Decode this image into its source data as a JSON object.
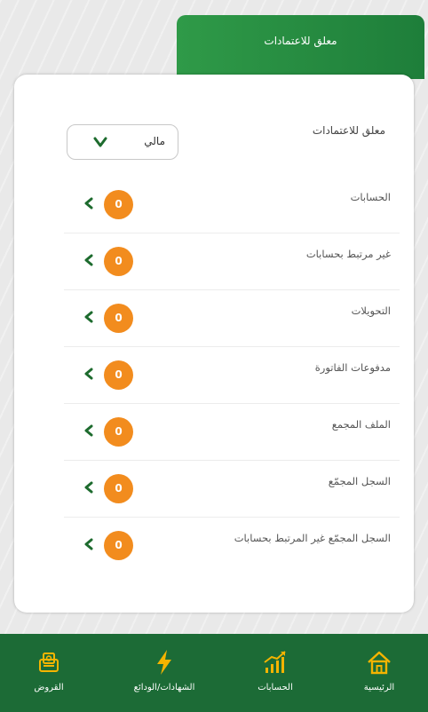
{
  "header": {
    "tab_label": "معلق للاعتمادات"
  },
  "filter": {
    "label": "معلق للاعتمادات",
    "selected": "مالي"
  },
  "rows": [
    {
      "label": "الحسابات",
      "count": "0"
    },
    {
      "label": "غير مرتبط بحسابات",
      "count": "0"
    },
    {
      "label": "التحويلات",
      "count": "0"
    },
    {
      "label": "مدفوعات الفاتورة",
      "count": "0"
    },
    {
      "label": "الملف المجمع",
      "count": "0"
    },
    {
      "label": "السجل المجمّع",
      "count": "0"
    },
    {
      "label": "السجل المجمّع غير المرتبط بحسابات",
      "count": "0"
    }
  ],
  "bottom_nav": {
    "items": [
      {
        "label": "القروض",
        "icon": "loan-icon"
      },
      {
        "label": "الشهادات/الودائع",
        "icon": "lightning-icon"
      },
      {
        "label": "الحسابات",
        "icon": "growth-chart-icon"
      },
      {
        "label": "الرئيسية",
        "icon": "home-icon"
      }
    ]
  },
  "colors": {
    "primary_green": "#1c6b36",
    "tab_green": "#2f9a48",
    "badge_orange": "#f28c1e",
    "chevron_green": "#1d6b2e",
    "nav_icon_yellow": "#f5b400"
  }
}
